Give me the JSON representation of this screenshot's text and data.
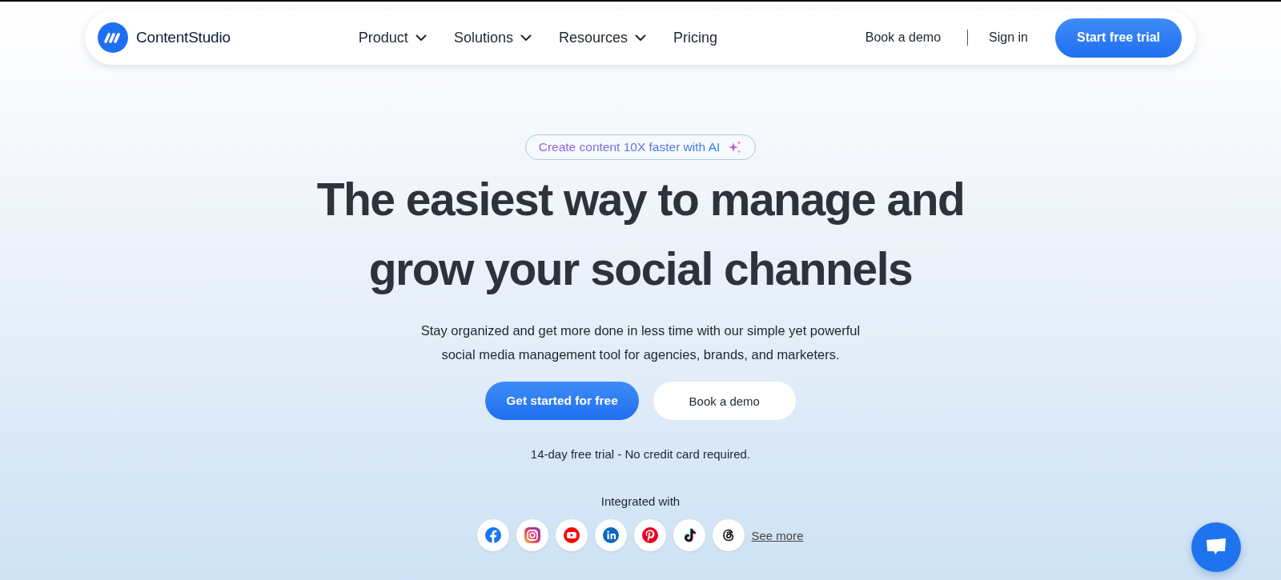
{
  "nav": {
    "brand": "ContentStudio",
    "menu": [
      {
        "label": "Product",
        "dropdown": true
      },
      {
        "label": "Solutions",
        "dropdown": true
      },
      {
        "label": "Resources",
        "dropdown": true
      },
      {
        "label": "Pricing",
        "dropdown": false
      }
    ],
    "book_demo": "Book a demo",
    "sign_in": "Sign in",
    "cta": "Start free trial"
  },
  "hero": {
    "badge": "Create content 10X faster with AI",
    "headline": [
      "The easiest way to manage and",
      "grow your social channels"
    ],
    "subtitle": [
      "Stay organized and get more done in less time with our simple yet powerful",
      "social media management tool for agencies, brands, and marketers."
    ],
    "primary_button": "Get started for free",
    "secondary_button": "Book a demo",
    "note": "14-day free trial - No credit card required.",
    "integrated_label": "Integrated with",
    "see_more": "See more"
  }
}
